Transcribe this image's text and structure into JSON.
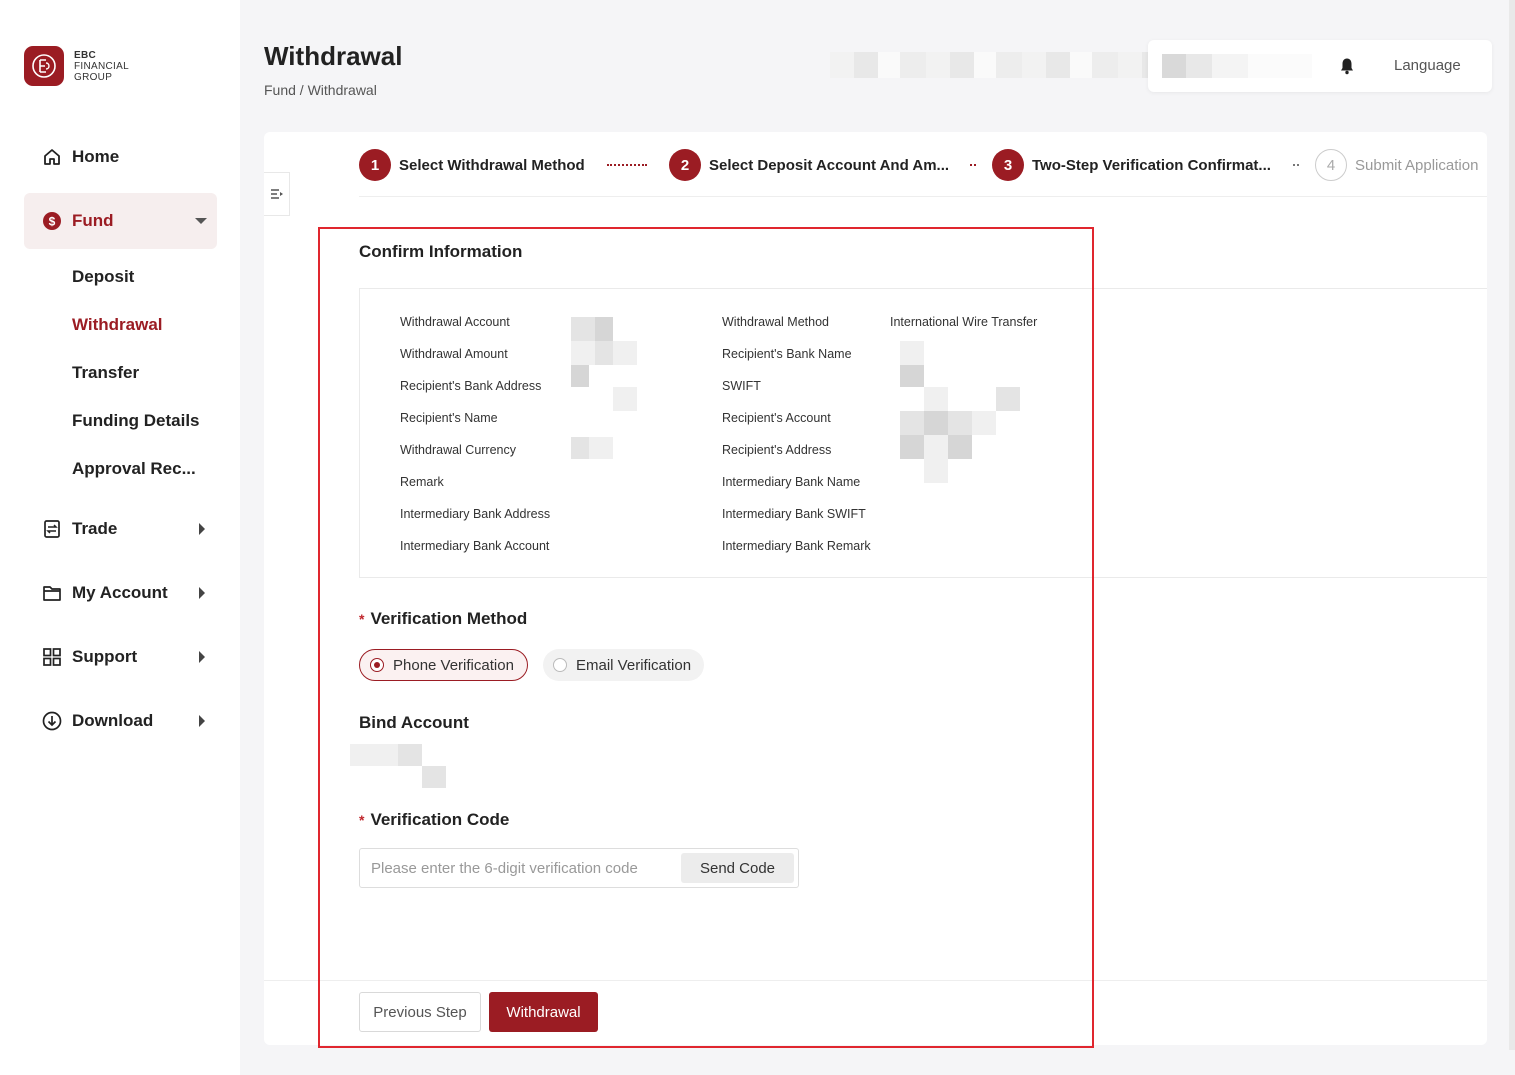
{
  "brand": {
    "line1": "EBC",
    "line2": "FINANCIAL",
    "line3": "GROUP",
    "color": "#9b1c23"
  },
  "sidebar": {
    "items": [
      {
        "label": "Home",
        "icon": "home-icon"
      },
      {
        "label": "Fund",
        "icon": "dollar-circle-icon",
        "expanded": true
      },
      {
        "label": "Trade",
        "icon": "trade-icon"
      },
      {
        "label": "My Account",
        "icon": "folder-icon"
      },
      {
        "label": "Support",
        "icon": "grid-icon"
      },
      {
        "label": "Download",
        "icon": "download-circle-icon"
      }
    ],
    "fund_sub": [
      "Deposit",
      "Withdrawal",
      "Transfer",
      "Funding Details",
      "Approval Rec..."
    ],
    "active_sub": "Withdrawal"
  },
  "header": {
    "title": "Withdrawal",
    "breadcrumb": "Fund / Withdrawal",
    "notification_icon": "bell-icon",
    "language": "Language"
  },
  "steps": [
    {
      "num": "1",
      "label": "Select Withdrawal Method",
      "state": "done"
    },
    {
      "num": "2",
      "label": "Select Deposit Account And Am...",
      "state": "done"
    },
    {
      "num": "3",
      "label": "Two-Step Verification Confirmat...",
      "state": "current"
    },
    {
      "num": "4",
      "label": "Submit Application",
      "state": "todo"
    }
  ],
  "confirm": {
    "title": "Confirm Information",
    "left_labels": [
      "Withdrawal Account",
      "Withdrawal Amount",
      "Recipient's Bank Address",
      "Recipient's Name",
      "Withdrawal Currency",
      "Remark",
      "Intermediary Bank Address",
      "Intermediary Bank Account"
    ],
    "right_labels": [
      "Withdrawal Method",
      "Recipient's Bank Name",
      "SWIFT",
      "Recipient's Account",
      "Recipient's Address",
      "Intermediary Bank Name",
      "Intermediary Bank SWIFT",
      "Intermediary Bank Remark"
    ],
    "withdrawal_method_value": "International Wire Transfer"
  },
  "verification": {
    "label": "Verification Method",
    "required_mark": "*",
    "options": [
      "Phone Verification",
      "Email Verification"
    ],
    "selected": "Phone Verification"
  },
  "bind_account": {
    "label": "Bind Account"
  },
  "code": {
    "label": "Verification Code",
    "required_mark": "*",
    "placeholder": "Please enter the 6-digit verification code",
    "value": "",
    "send_label": "Send Code"
  },
  "actions": {
    "previous": "Previous Step",
    "submit": "Withdrawal"
  },
  "colors": {
    "accent": "#9b1c23",
    "highlight": "#e0262e"
  }
}
